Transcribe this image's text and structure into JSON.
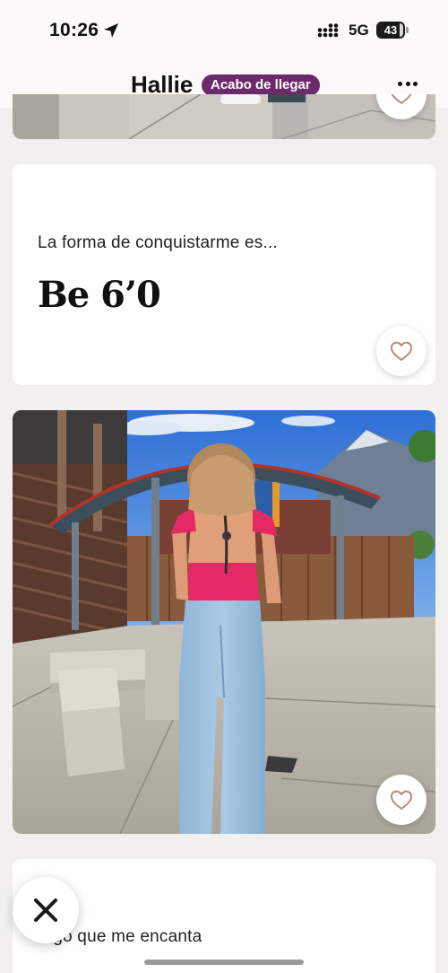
{
  "status_bar": {
    "time": "10:26",
    "network": "5G",
    "battery": "43",
    "icons": [
      "location-arrow-icon",
      "signal-icon",
      "battery-icon"
    ]
  },
  "header": {
    "name": "Hallie",
    "badge": "Acabo de llegar",
    "more_icon": "more-horizontal-icon"
  },
  "prompts": [
    {
      "label": "La forma de conquistarme es...",
      "answer": "Be 6’0"
    },
    {
      "label": "Algo que me encanta"
    }
  ],
  "photo": {
    "description_icon": "photo-image"
  },
  "actions": {
    "like_icon": "heart-icon",
    "pass_icon": "close-icon"
  },
  "colors": {
    "badge": "#6c2a6a",
    "heart": "#b98f7f",
    "background": "#f1f0ef"
  }
}
